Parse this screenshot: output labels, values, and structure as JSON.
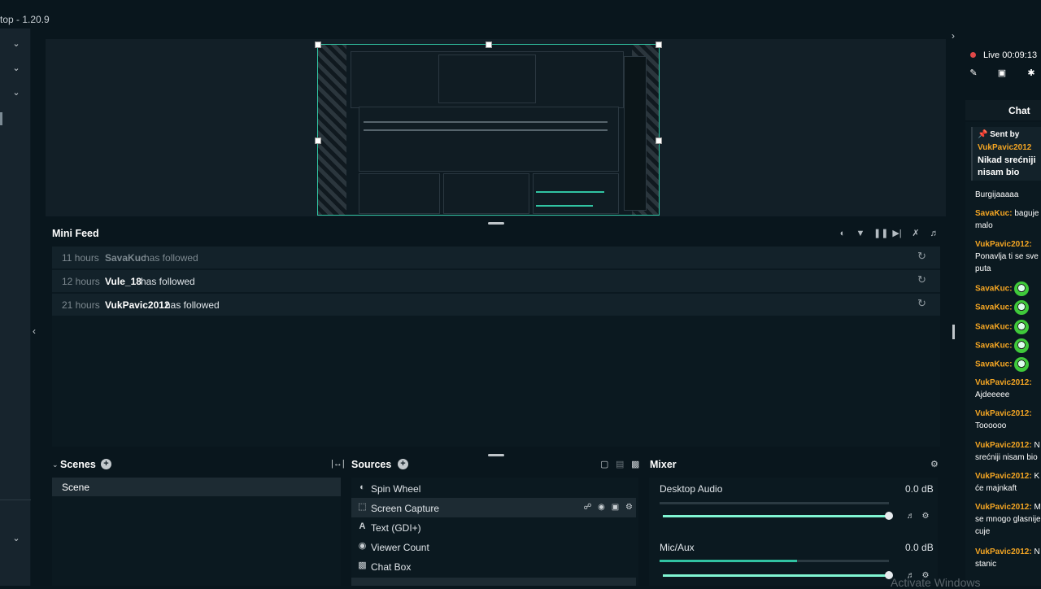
{
  "window": {
    "title": "top - 1.20.9"
  },
  "leftnav": {
    "chevrons": [
      "chevron-down-icon",
      "chevron-down-icon",
      "chevron-down-icon",
      "chevron-down-icon"
    ]
  },
  "minifeed": {
    "title": "Mini Feed",
    "toolbar_icons": [
      "clear-icon",
      "filter-icon",
      "pause-icon",
      "skip-icon",
      "mute-alerts-icon",
      "volume-icon"
    ],
    "rows": [
      {
        "time": "11 hours",
        "user": "SavaKuc",
        "action": "has followed"
      },
      {
        "time": "12 hours",
        "user": "Vule_18",
        "action": "has followed"
      },
      {
        "time": "21 hours",
        "user": "VukPavic2012",
        "action": "has followed"
      }
    ]
  },
  "scenes": {
    "title": "Scenes",
    "items": [
      "Scene"
    ]
  },
  "sources": {
    "title": "Sources",
    "items": [
      {
        "label": "Spin Wheel",
        "icon": "spin-wheel-icon"
      },
      {
        "label": "Screen Capture",
        "icon": "screen-capture-icon"
      },
      {
        "label": "Text (GDI+)",
        "icon": "text-icon"
      },
      {
        "label": "Viewer Count",
        "icon": "eye-icon"
      },
      {
        "label": "Chat Box",
        "icon": "chat-icon"
      }
    ]
  },
  "mixer": {
    "title": "Mixer",
    "channels": [
      {
        "name": "Desktop Audio",
        "db": "0.0 dB",
        "level": 1.0
      },
      {
        "name": "Mic/Aux",
        "db": "0.0 dB",
        "level": 1.0
      }
    ]
  },
  "rightpanel": {
    "live_label": "Live",
    "timer": "00:09:13",
    "chat_tab": "Chat",
    "pinned": {
      "header": "Sent by",
      "user": "VukPavic2012",
      "message": "Nikad srećniji nisam bio"
    },
    "messages": [
      {
        "user": "",
        "text": "Burgijaaaaa"
      },
      {
        "user": "SavaKuc:",
        "text": "baguje malo"
      },
      {
        "user": "VukPavic2012:",
        "text": "Ponavlja ti se sve puta"
      },
      {
        "user": "SavaKuc:",
        "text": ""
      },
      {
        "user": "SavaKuc:",
        "text": ""
      },
      {
        "user": "SavaKuc:",
        "text": ""
      },
      {
        "user": "SavaKuc:",
        "text": ""
      },
      {
        "user": "SavaKuc:",
        "text": ""
      },
      {
        "user": "VukPavic2012:",
        "text": "Ajdeeeee"
      },
      {
        "user": "VukPavic2012:",
        "text": "Toooooo"
      },
      {
        "user": "VukPavic2012:",
        "text": "N srećniji nisam bio"
      },
      {
        "user": "VukPavic2012:",
        "text": "K će majnkaft"
      },
      {
        "user": "VukPavic2012:",
        "text": "M se mnogo glasnije cuje"
      },
      {
        "user": "VukPavic2012:",
        "text": "N stanic"
      }
    ]
  },
  "watermark": "Activate Windows"
}
